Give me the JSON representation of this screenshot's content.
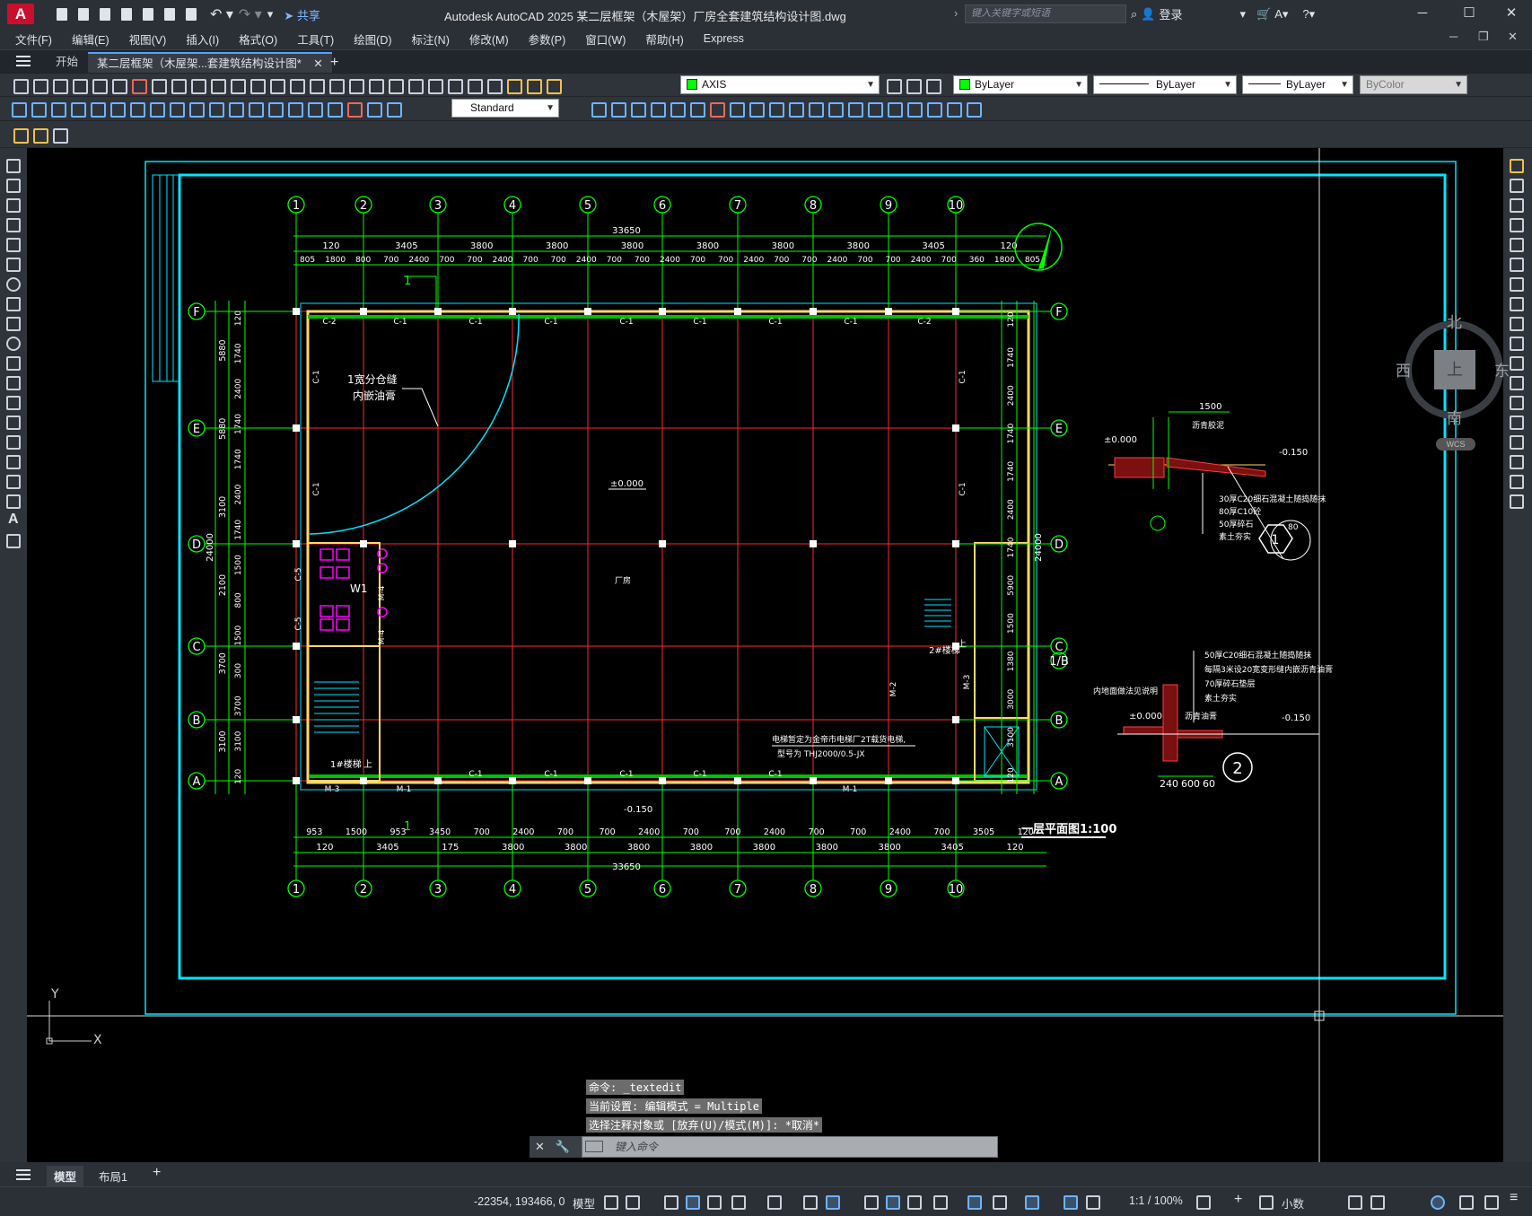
{
  "app": {
    "title": "Autodesk AutoCAD 2025    某二层框架（木屋架）厂房全套建筑结构设计图.dwg",
    "logo": "A",
    "share_label": "共享",
    "search_placeholder": "键入关键字或短语",
    "login_label": "登录"
  },
  "menu": [
    "文件(F)",
    "编辑(E)",
    "视图(V)",
    "插入(I)",
    "格式(O)",
    "工具(T)",
    "绘图(D)",
    "标注(N)",
    "修改(M)",
    "参数(P)",
    "窗口(W)",
    "帮助(H)",
    "Express"
  ],
  "tabs": {
    "start": "开始",
    "active": "某二层框架（木屋架...套建筑结构设计图*",
    "close": "✕",
    "new": "+"
  },
  "props": {
    "layer": "AXIS",
    "color": "ByLayer",
    "linetype": "ByLayer",
    "lineweight": "ByLayer",
    "plotstyle": "ByColor",
    "textstyle": "Standard"
  },
  "colors": {
    "layer_swatch": "#00ff00",
    "color_swatch": "#00ff00",
    "canvas": "#000000",
    "axis": "#00ff00",
    "wall": "#ffd966",
    "frame": "#00e5ff",
    "grid": "#ff2a2a",
    "text": "#ffffff",
    "sanitary": "#ff00ff"
  },
  "viewcube": {
    "north": "北",
    "south": "南",
    "east": "东",
    "west": "西",
    "top": "上",
    "wcs": "WCS"
  },
  "command": {
    "history": [
      "命令: _textedit",
      "当前设置: 编辑模式 = Multiple",
      "选择注释对象或 [放弃(U)/模式(M)]: *取消*"
    ],
    "placeholder": "键入命令"
  },
  "layouts": {
    "model": "模型",
    "layout1": "布局1",
    "add": "+"
  },
  "status": {
    "coords": "-22354, 193466, 0",
    "model": "模型",
    "scale": "1:1 / 100%",
    "units": "小数"
  },
  "ucs": {
    "x": "X",
    "y": "Y"
  },
  "drawing": {
    "axes_numbers": [
      "1",
      "2",
      "3",
      "4",
      "5",
      "6",
      "7",
      "8",
      "9",
      "10"
    ],
    "axes_letters": [
      "F",
      "E",
      "D",
      "C",
      "B",
      "A"
    ],
    "extra_axis": "1/B",
    "total_width": "33650",
    "total_depth": "24000",
    "bay_dims_top": [
      "120",
      "3405",
      "3800",
      "3800",
      "3800",
      "3800",
      "3800",
      "3800",
      "3405",
      "120"
    ],
    "sub_dims_top": [
      "805",
      "1800",
      "800",
      "700",
      "2400",
      "700",
      "700",
      "2400",
      "700",
      "700",
      "2400",
      "700",
      "700",
      "2400",
      "700",
      "700",
      "2400",
      "700",
      "700",
      "2400",
      "700",
      "700",
      "2400",
      "700",
      "360",
      "1800",
      "805"
    ],
    "bottom_dims_1": [
      "953",
      "1500",
      "953",
      "3450",
      "700",
      "2400",
      "700",
      "700",
      "2400",
      "700",
      "700",
      "2400",
      "700",
      "700",
      "2400",
      "700",
      "3505",
      "120"
    ],
    "bottom_dims_2": [
      "120",
      "3405",
      "175",
      "3800",
      "3800",
      "3800",
      "3800",
      "3800",
      "3800",
      "3800",
      "3405",
      "120"
    ],
    "left_dims": [
      "120",
      "1740",
      "2400",
      "1740",
      "1740",
      "2400",
      "1740",
      "1500",
      "800",
      "1500",
      "300",
      "3700",
      "3100",
      "120"
    ],
    "left_totals": [
      "5880",
      "5880",
      "3100",
      "2100",
      "3700",
      "3100"
    ],
    "right_dims": [
      "120",
      "1740",
      "2400",
      "1740",
      "1740",
      "2400",
      "1740",
      "5900",
      "1500",
      "1380",
      "3000",
      "3100",
      "120"
    ],
    "window_labels": {
      "c1": "C-1",
      "c2": "C-2",
      "c5": "C-5",
      "m1": "M-1",
      "m2": "M-2",
      "m3": "M-3",
      "m4": "M-4"
    },
    "elev_zero": "±0.000",
    "elev_neg": "-0.150",
    "note_joint": "1宽分仓缝",
    "note_joint2": "内嵌油膏",
    "room_factory": "厂房",
    "stair1": "1#楼梯",
    "stair2": "2#楼梯",
    "up": "上",
    "wc": "W1",
    "elevator_note1": "电梯暂定为金帝市电梯厂2T载货电梯,",
    "elevator_note2": "型号为 THJ2000/0.5-JX",
    "plan_title": "一层平面图1:100",
    "detail1": {
      "mark": "1",
      "width": "1500",
      "angle": "80",
      "label_top": "沥青胶泥",
      "layers": [
        "30厚C20细石混凝土随捣随抹",
        "80厚C10砼",
        "50厚碎石",
        "素土夯实"
      ]
    },
    "detail2": {
      "mark": "2",
      "layers": [
        "50厚C20细石混凝土随捣随抹",
        "每隔3米设20宽变形缝内嵌沥青油膏",
        "70厚碎石垫层",
        "素土夯实"
      ],
      "note_left": "内地面做法见说明",
      "note_mid": "沥青油膏",
      "dims": [
        "240",
        "600",
        "60"
      ]
    },
    "section_mark": "1"
  }
}
